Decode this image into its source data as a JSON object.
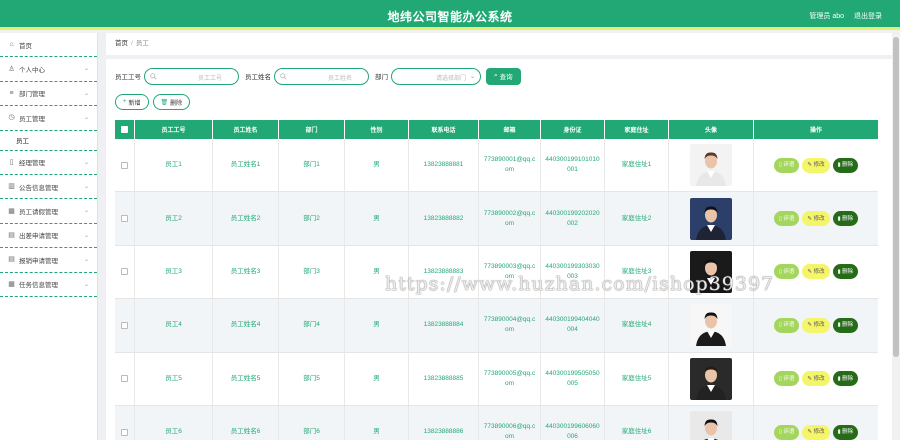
{
  "header": {
    "title": "地纬公司智能办公系统",
    "user": "管理员 abo",
    "logout": "退出登录"
  },
  "sidebar": {
    "items": [
      {
        "label": "首页",
        "icon": "home-icon",
        "glyph": "⌂"
      },
      {
        "label": "个人中心",
        "icon": "user-icon",
        "glyph": "♙"
      },
      {
        "label": "部门管理",
        "icon": "list-icon",
        "glyph": "≡"
      },
      {
        "label": "员工管理",
        "icon": "clock-icon",
        "glyph": "◷"
      },
      {
        "label": "经理管理",
        "icon": "phone-icon",
        "glyph": "▯"
      },
      {
        "label": "公告信息管理",
        "icon": "chart-icon",
        "glyph": "▥"
      },
      {
        "label": "员工请假管理",
        "icon": "grid-icon",
        "glyph": "▦"
      },
      {
        "label": "出差申请管理",
        "icon": "folder-icon",
        "glyph": "▤"
      },
      {
        "label": "报销申请管理",
        "icon": "folder-icon",
        "glyph": "▤"
      },
      {
        "label": "任务信息管理",
        "icon": "table-icon",
        "glyph": "▦"
      }
    ],
    "sub_item": "员工"
  },
  "breadcrumb": {
    "home": "首页",
    "sep": "/",
    "current": "员工"
  },
  "search": {
    "emp_no_label": "员工工号",
    "emp_no_placeholder": "员工工号",
    "emp_name_label": "员工姓名",
    "emp_name_placeholder": "员工姓名",
    "dept_label": "部门",
    "dept_placeholder": "请选择部门",
    "query_button": "查询"
  },
  "actions": {
    "add": "新增",
    "delete": "删除"
  },
  "table": {
    "headers": [
      "员工工号",
      "员工姓名",
      "部门",
      "性别",
      "联系电话",
      "邮箱",
      "身份证",
      "家庭住址",
      "头像",
      "操作"
    ],
    "op_labels": {
      "review": "评语",
      "edit": "修改",
      "delete": "删除"
    },
    "rows": [
      {
        "no": "员工1",
        "name": "员工姓名1",
        "dept": "部门1",
        "gender": "男",
        "phone": "13823888881",
        "email": "773890001@qq.com",
        "id": "440300199101010001",
        "addr": "家庭住址1"
      },
      {
        "no": "员工2",
        "name": "员工姓名2",
        "dept": "部门2",
        "gender": "男",
        "phone": "13823888882",
        "email": "773890002@qq.com",
        "id": "440300199202020002",
        "addr": "家庭住址2"
      },
      {
        "no": "员工3",
        "name": "员工姓名3",
        "dept": "部门3",
        "gender": "男",
        "phone": "13823888883",
        "email": "773890003@qq.com",
        "id": "440300199303030003",
        "addr": "家庭住址3"
      },
      {
        "no": "员工4",
        "name": "员工姓名4",
        "dept": "部门4",
        "gender": "男",
        "phone": "13823888884",
        "email": "773890004@qq.com",
        "id": "440300199404040004",
        "addr": "家庭住址4"
      },
      {
        "no": "员工5",
        "name": "员工姓名5",
        "dept": "部门5",
        "gender": "男",
        "phone": "13823888885",
        "email": "773890005@qq.com",
        "id": "440300199505050005",
        "addr": "家庭住址5"
      },
      {
        "no": "员工6",
        "name": "员工姓名6",
        "dept": "部门6",
        "gender": "男",
        "phone": "13823888886",
        "email": "773890006@qq.com",
        "id": "440300199606060006",
        "addr": "家庭住址6"
      }
    ]
  },
  "watermark": "https://www.huzhan.com/ishop39397",
  "colors": {
    "primary": "#21a874",
    "accent": "#e4f26a",
    "review": "#a4d65e",
    "edit": "#f5f56a",
    "delete": "#256b18"
  }
}
